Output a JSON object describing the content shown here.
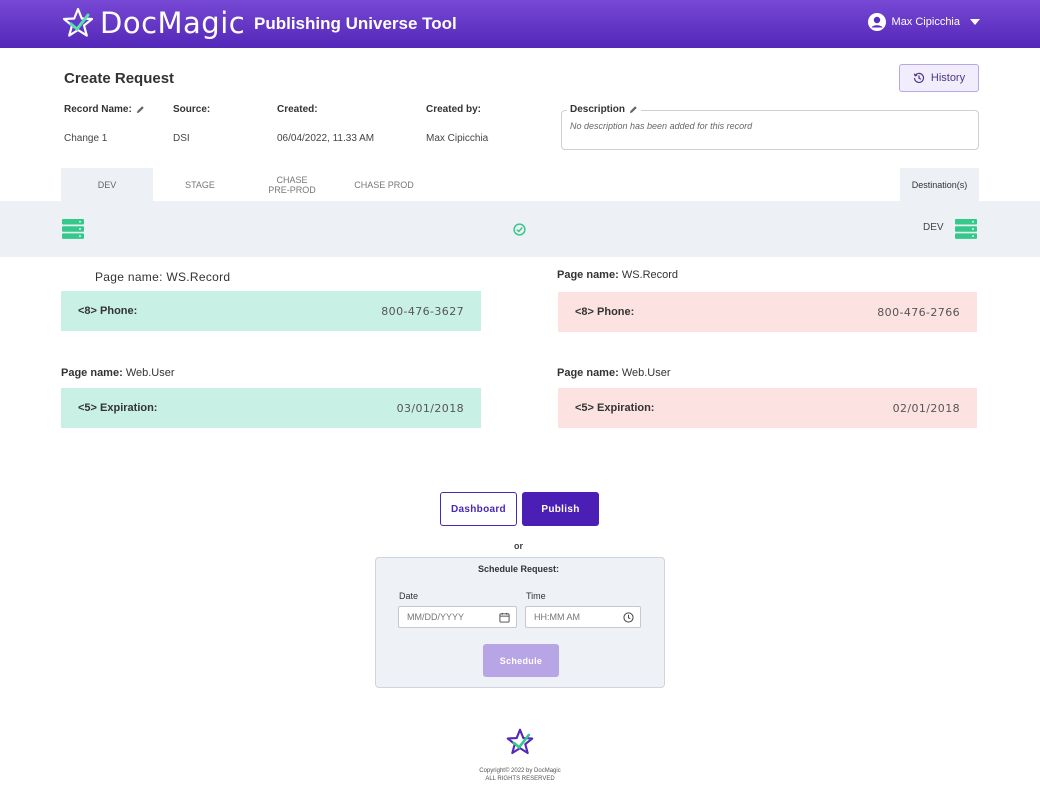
{
  "header": {
    "brand": "DocMagic",
    "app_title": "Publishing Universe Tool",
    "user_name": "Max Cipicchia"
  },
  "request": {
    "title": "Create Request",
    "history_label": "History",
    "record_name_label": "Record Name:",
    "record_name": "Change 1",
    "source_label": "Source:",
    "source": "DSI",
    "created_label": "Created:",
    "created": "06/04/2022, 11.33 AM",
    "created_by_label": "Created by:",
    "created_by": "Max Cipicchia",
    "description_label": "Description",
    "description": "No description has been added for this record"
  },
  "tabs": [
    {
      "label": "DEV"
    },
    {
      "label": "STAGE"
    },
    {
      "label": "CHASE\nPRE-PROD"
    },
    {
      "label": "CHASE PROD"
    }
  ],
  "destination_label": "Destination(s)",
  "status": {
    "destination_name": "DEV"
  },
  "comparisons": [
    {
      "page_label": "Page name:",
      "page_name": "WS.Record",
      "field": "<8> Phone:",
      "source_value": "800-476-3627",
      "destination_value": "800-476-2766"
    },
    {
      "page_label": "Page name:",
      "page_name": "Web.User",
      "field": "<5> Expiration:",
      "source_value": "03/01/2018",
      "destination_value": "02/01/2018"
    }
  ],
  "actions": {
    "dashboard_label": "Dashboard",
    "publish_label": "Publish",
    "or_text": "or"
  },
  "schedule": {
    "title": "Schedule Request:",
    "date_label": "Date",
    "date_placeholder": "MM/DD/YYYY",
    "time_label": "Time",
    "time_placeholder": "HH:MM AM",
    "button_label": "Schedule"
  },
  "footer": {
    "copyright_line1": "Copyright© 2022 by DocMagic",
    "copyright_line2": "ALL RIGHTS RESERVED"
  },
  "colors": {
    "header_gradient_top": "#7748d4",
    "header_gradient_bottom": "#5327b8",
    "primary": "#4b1fb5",
    "source_bg": "#c9f0e5",
    "destination_bg": "#fde2e2",
    "server_green": "#34c88a"
  }
}
